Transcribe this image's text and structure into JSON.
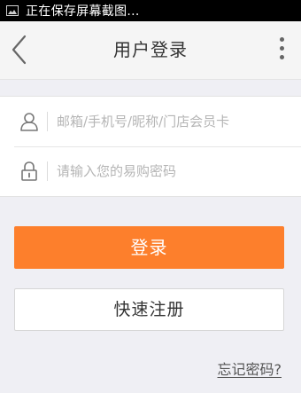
{
  "status_bar": {
    "text": "正在保存屏幕截图...",
    "icon": "image-icon"
  },
  "nav": {
    "title": "用户登录",
    "back_icon": "chevron-left-icon",
    "more_icon": "more-vertical-icon"
  },
  "form": {
    "account": {
      "icon": "user-icon",
      "placeholder": "邮箱/手机号/昵称/门店会员卡",
      "value": ""
    },
    "password": {
      "icon": "lock-icon",
      "placeholder": "请输入您的易购密码",
      "value": ""
    }
  },
  "actions": {
    "login_label": "登录",
    "register_label": "快速注册",
    "forgot_label": "忘记密码?"
  },
  "colors": {
    "accent": "#fd7f2c",
    "background": "#efeff4"
  }
}
